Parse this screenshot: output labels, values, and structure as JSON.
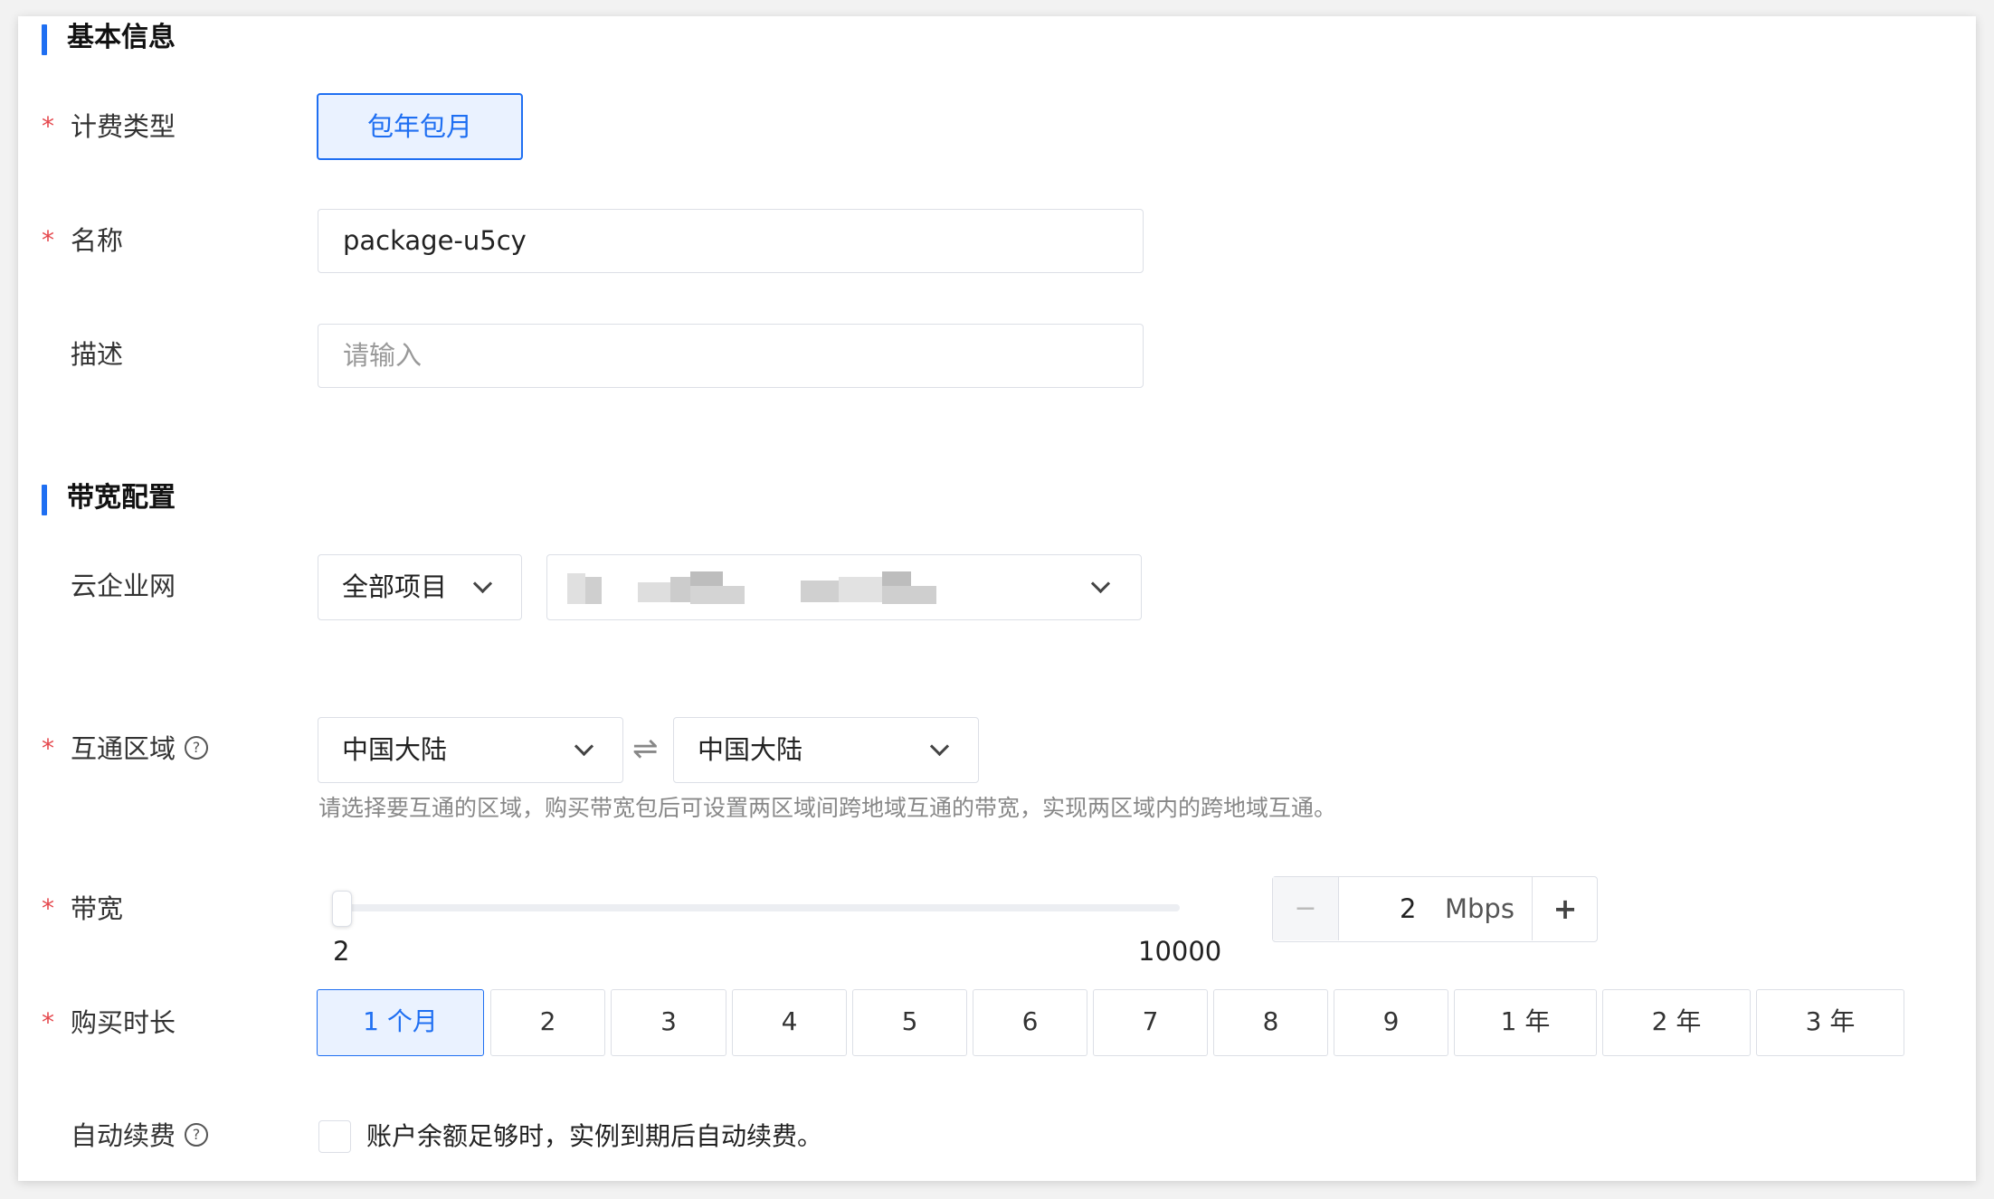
{
  "basic": {
    "title": "基本信息",
    "billing_label": "计费类型",
    "billing_value": "包年包月",
    "name_label": "名称",
    "name_value": "package-u5cy",
    "desc_label": "描述",
    "desc_placeholder": "请输入"
  },
  "bandwidth_config": {
    "title": "带宽配置",
    "ccn_label": "云企业网",
    "project_select": "全部项目",
    "region_label": "互通区域",
    "region_from": "中国大陆",
    "region_to": "中国大陆",
    "swap_symbol": "⇌",
    "region_hint": "请选择要互通的区域，购买带宽包后可设置两区域间跨地域互通的带宽，实现两区域内的跨地域互通。",
    "bw_label": "带宽",
    "slider_min": "2",
    "slider_max": "10000",
    "slider_value": 2,
    "stepper_minus": "−",
    "stepper_value": "2",
    "stepper_unit": "Mbps",
    "stepper_plus": "+",
    "duration_label": "购买时长",
    "duration_options": [
      "1 个月",
      "2",
      "3",
      "4",
      "5",
      "6",
      "7",
      "8",
      "9",
      "1 年",
      "2 年",
      "3 年"
    ],
    "duration_selected": "1 个月",
    "auto_renew_label": "自动续费",
    "auto_renew_text": "账户余额足够时，实例到期后自动续费。",
    "auto_renew_checked": false
  },
  "colors": {
    "accent": "#1f6ff2",
    "required": "#e5484d",
    "border": "#dcdfe6"
  }
}
